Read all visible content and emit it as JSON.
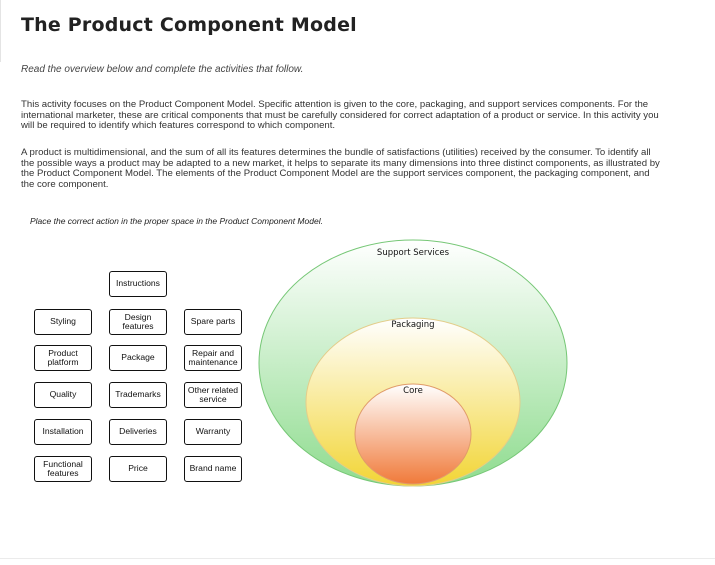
{
  "header": {
    "title": "The Product Component Model",
    "subtitle": "Read the overview below and complete the activities that follow."
  },
  "overview": {
    "paragraph_1": "This activity focuses on the Product Component Model. Specific attention is given to the core, packaging, and support services components. For the international marketer, these are critical components that must be carefully considered for correct adaptation of a product or service. In this activity you will be required to identify which features correspond to which component.",
    "paragraph_2": "A product is multidimensional, and the sum of all its features determines the bundle of satisfactions (utilities) received by the consumer. To identify all the possible ways a product may be adapted to a new market, it helps to separate its many dimensions into three distinct components, as illustrated by the Product Component Model. The elements of the Product Component Model are the support services component, the packaging component, and the core component."
  },
  "activity": {
    "instruction": "Place the correct action in the proper space in the Product Component Model.",
    "items": [
      {
        "label": "Instructions"
      },
      {
        "label": "Styling"
      },
      {
        "label": "Design features"
      },
      {
        "label": "Spare parts"
      },
      {
        "label": "Product platform"
      },
      {
        "label": "Package"
      },
      {
        "label": "Repair and maintenance"
      },
      {
        "label": "Quality"
      },
      {
        "label": "Trademarks"
      },
      {
        "label": "Other related service"
      },
      {
        "label": "Installation"
      },
      {
        "label": "Deliveries"
      },
      {
        "label": "Warranty"
      },
      {
        "label": "Functional features"
      },
      {
        "label": "Price"
      },
      {
        "label": "Brand name"
      }
    ]
  },
  "model": {
    "outer_label": "Support Services",
    "middle_label": "Packaging",
    "inner_label": "Core",
    "colors": {
      "outer_top": "#ffffff",
      "outer_bottom": "#8fdc8f",
      "outer_stroke": "#76c776",
      "middle_top": "#ffffff",
      "middle_bottom": "#f2d535",
      "middle_stroke": "#e3cd8a",
      "inner_top": "#ffffff",
      "inner_bottom": "#f07a3a",
      "inner_stroke": "#e09b6a"
    }
  }
}
